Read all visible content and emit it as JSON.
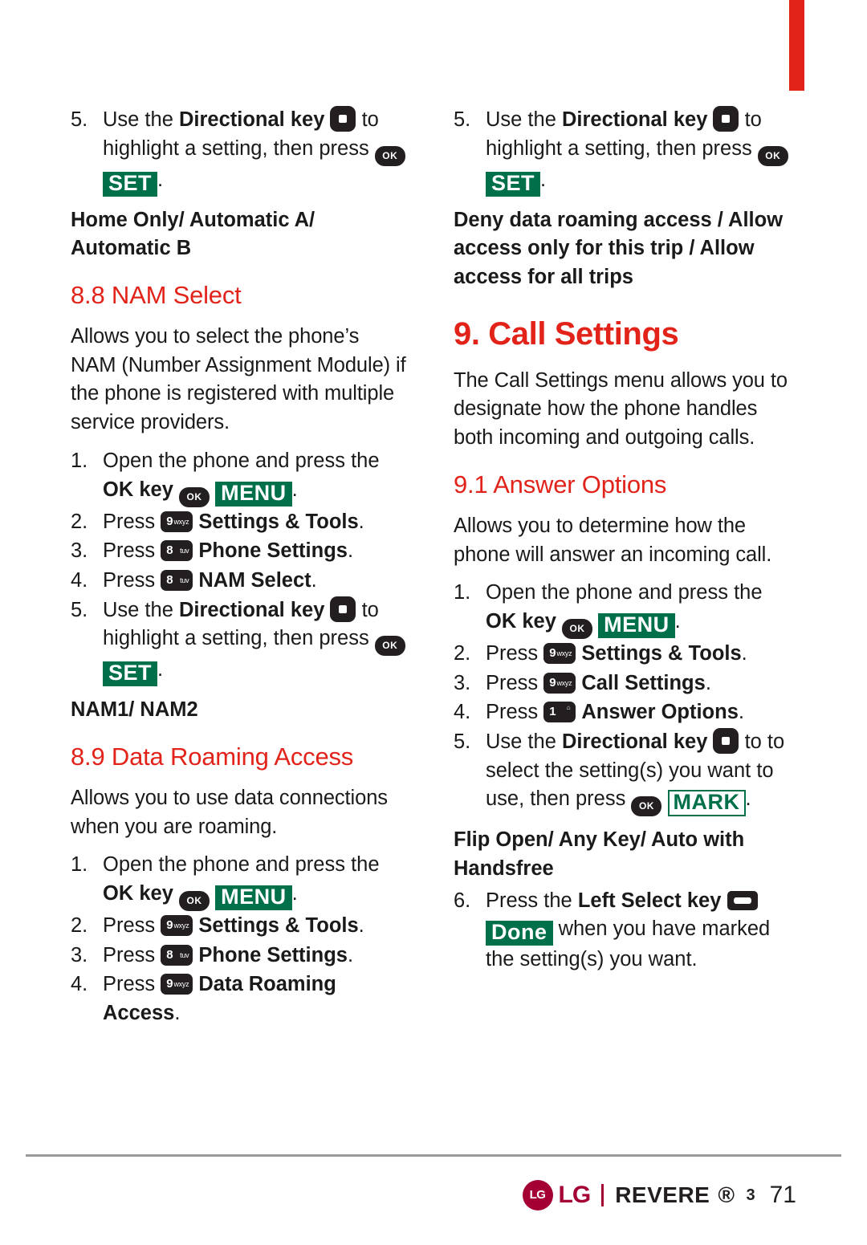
{
  "page": {
    "number": "71",
    "brand": "LG",
    "model": "REVERE",
    "model_suffix": "3",
    "trademark": "®"
  },
  "keys": {
    "ok": "OK",
    "set": "SET",
    "menu": "MENU",
    "mark": "MARK",
    "done": "Done",
    "num9": "9",
    "num9_sub": "wxyz",
    "num8": "8",
    "num8_sub": "tuv",
    "num1": "1",
    "num1_sub": "⌂"
  },
  "left_column": {
    "step5_top": {
      "num": "5.",
      "part1": "Use the ",
      "bold1": "Directional key",
      "part2": " to highlight a setting, then press ",
      "tail": "."
    },
    "options_top": "Home Only/ Automatic A/ Automatic B",
    "section_88": "8.8 NAM Select",
    "intro_88": "Allows you to select the phone’s NAM (Number Assignment Module) if the phone is registered with multiple service providers.",
    "steps_88": [
      {
        "num": "1.",
        "text": "Open the phone and press the ",
        "bold": "OK key",
        "tail": "."
      },
      {
        "num": "2.",
        "text": "Press ",
        "bold": "Settings & Tools",
        "tail": "."
      },
      {
        "num": "3.",
        "text": "Press ",
        "bold": "Phone Settings",
        "tail": "."
      },
      {
        "num": "4.",
        "text": "Press ",
        "bold": "NAM Select",
        "tail": "."
      }
    ],
    "step5_mid": {
      "num": "5.",
      "part1": "Use the ",
      "bold1": "Directional key",
      "part2": " to highlight a setting, then press ",
      "tail": "."
    },
    "options_mid": "NAM1/ NAM2",
    "section_89": "8.9 Data Roaming Access",
    "intro_89": "Allows you to use data connections when you are roaming.",
    "steps_89": [
      {
        "num": "1.",
        "text": "Open the phone and press the ",
        "bold": "OK key",
        "tail": "."
      },
      {
        "num": "2.",
        "text": "Press ",
        "bold": "Settings & Tools",
        "tail": "."
      },
      {
        "num": "3.",
        "text": "Press ",
        "bold": "Phone Settings",
        "tail": "."
      },
      {
        "num": "4.",
        "text": "Press ",
        "bold": "Data Roaming Access",
        "tail": "."
      }
    ]
  },
  "right_column": {
    "step5_top": {
      "num": "5.",
      "part1": "Use the ",
      "bold1": "Directional key",
      "part2": " to highlight a setting, then press ",
      "tail": "."
    },
    "options_top": "Deny data roaming access / Allow access only for this trip / Allow access for all trips",
    "chapter_9": "9. Call Settings",
    "intro_9": "The Call Settings menu allows you to designate how the phone handles both incoming and outgoing calls.",
    "section_91": "9.1 Answer Options",
    "intro_91": "Allows you to determine how the phone will answer an incoming call.",
    "steps_91": [
      {
        "num": "1.",
        "text": "Open the phone and press the ",
        "bold": "OK key",
        "tail": "."
      },
      {
        "num": "2.",
        "text": "Press ",
        "bold": "Settings & Tools",
        "tail": "."
      },
      {
        "num": "3.",
        "text": "Press ",
        "bold": "Call Settings",
        "tail": "."
      },
      {
        "num": "4.",
        "text": "Press ",
        "bold": "Answer Options",
        "tail": "."
      }
    ],
    "step5": {
      "num": "5.",
      "part1": "Use the ",
      "bold1": "Directional key",
      "part2": " to to select the setting(s) you want to use, then press ",
      "tail": "."
    },
    "options_91": "Flip Open/ Any Key/ Auto with Handsfree",
    "step6": {
      "num": "6.",
      "part1": "Press the ",
      "bold1": "Left Select key",
      "part2": " when you have marked the setting(s) you want."
    }
  },
  "colors": {
    "accent_red": "#e2231a",
    "key_green": "#00704a",
    "key_black": "#231f20",
    "lg_magenta": "#a50034"
  }
}
